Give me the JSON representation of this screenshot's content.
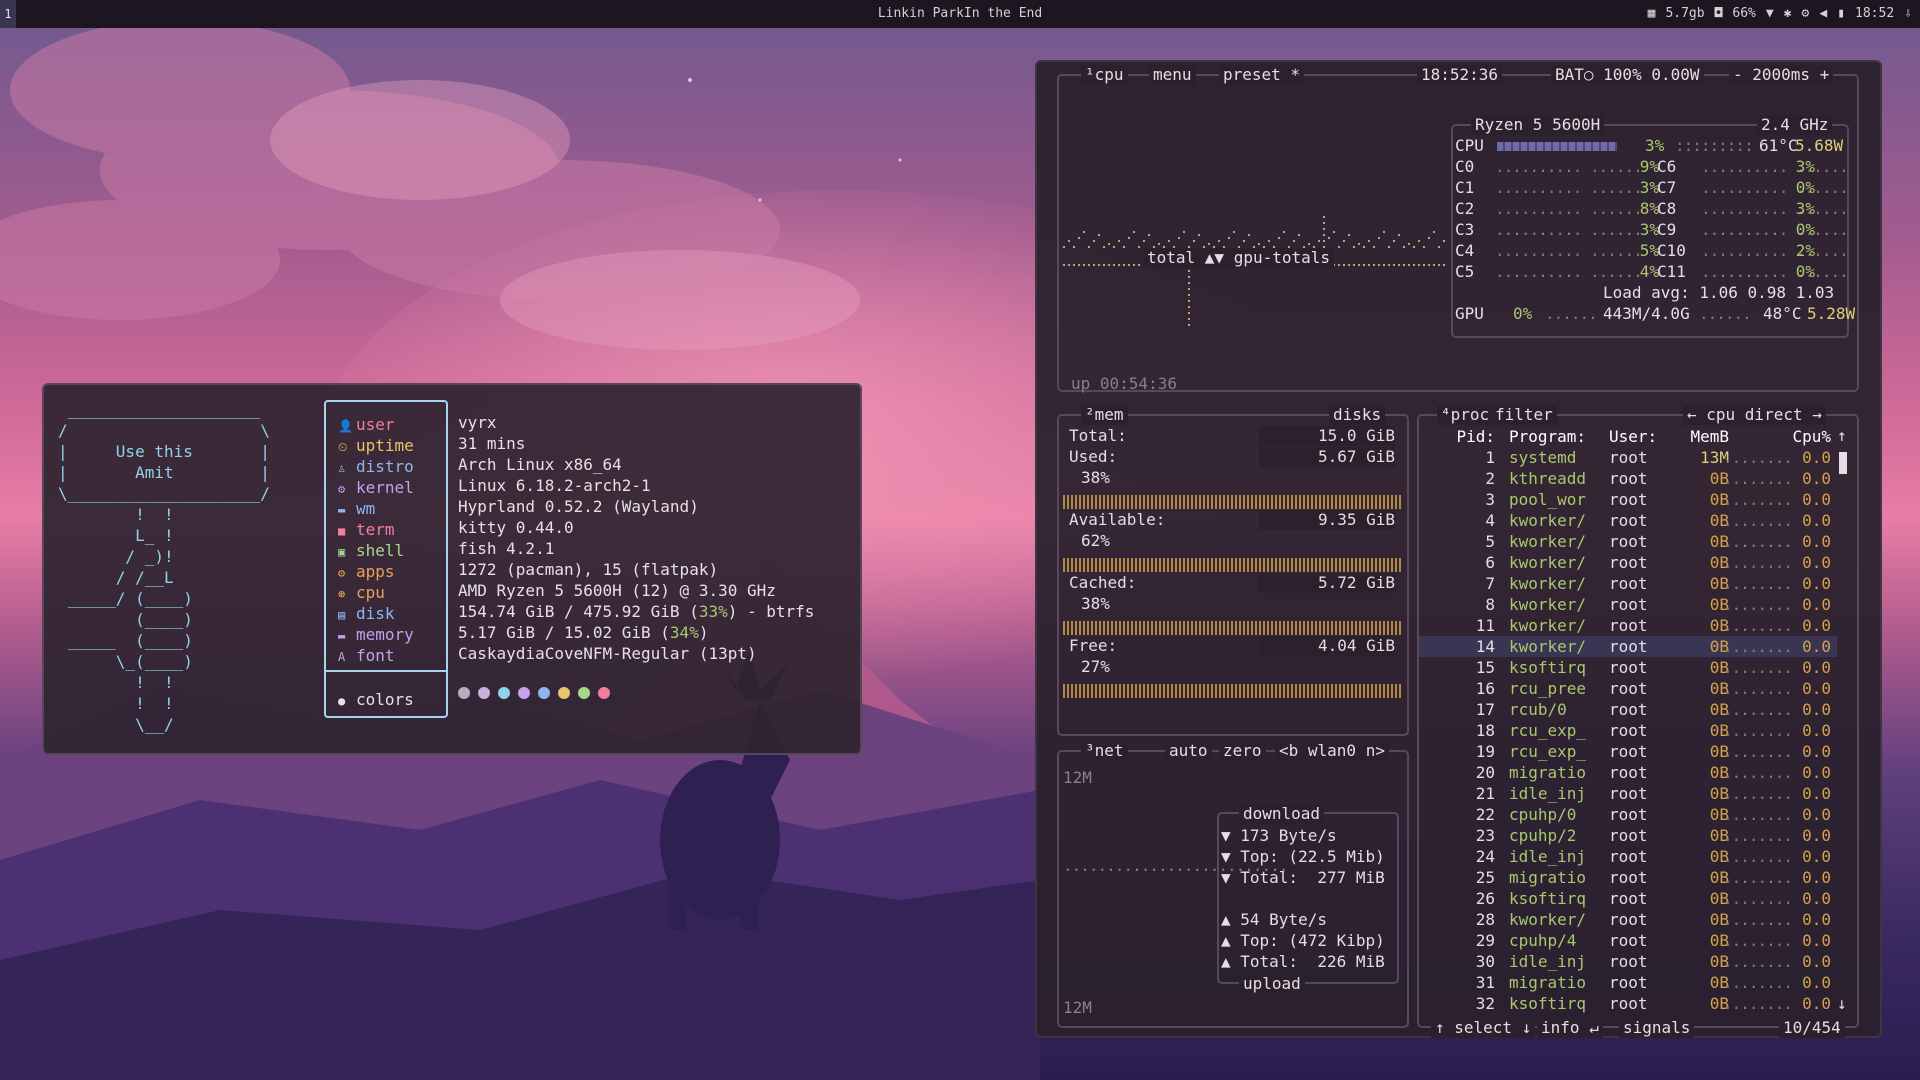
{
  "topbar": {
    "workspace": "1",
    "title": "Linkin ParkIn the End",
    "tray": {
      "memory": "5.7gb",
      "battery": "66%",
      "time": "18:52"
    }
  },
  "fastfetch": {
    "ascii": [
      " ____________________\n/                    \\\n|     Use this       |\n|       Amit         |\n\\____________________/\n        !  !\n        L_ !\n       / _)!\n      / /__L\n _____/ (____)\n        (____)\n _____  (____)\n      \\_(____)\n        !  !\n        !  !\n        \\__/"
    ],
    "keys": [
      {
        "icon": "👤",
        "label": "user",
        "color": "#ef7f9a"
      },
      {
        "icon": "⏲",
        "label": "uptime",
        "color": "#e8c46a"
      },
      {
        "icon": "♙",
        "label": "distro",
        "color": "#8fb5ef"
      },
      {
        "icon": "⚙",
        "label": "kernel",
        "color": "#c6a0ea"
      },
      {
        "icon": "▬",
        "label": "wm",
        "color": "#8fb5ef"
      },
      {
        "icon": "■",
        "label": "term",
        "color": "#ef7f9a"
      },
      {
        "icon": "▣",
        "label": "shell",
        "color": "#a8d78a"
      },
      {
        "icon": "⚙",
        "label": "apps",
        "color": "#e8a25a"
      },
      {
        "icon": "⊛",
        "label": "cpu",
        "color": "#e8a25a"
      },
      {
        "icon": "▤",
        "label": "disk",
        "color": "#8fb5ef"
      },
      {
        "icon": "▬",
        "label": "memory",
        "color": "#c6a0ea"
      },
      {
        "icon": "A",
        "label": "font",
        "color": "#c6a0ea"
      }
    ],
    "colors_label": "colors",
    "values": [
      "vyrx",
      "31 mins",
      "Arch Linux x86_64",
      "Linux 6.18.2-arch2-1",
      "Hyprland 0.52.2 (Wayland)",
      "kitty 0.44.0",
      "fish 4.2.1",
      "1272 (pacman), 15 (flatpak)",
      "AMD Ryzen 5 5600H (12) @ 3.30 GHz",
      "",
      "",
      "CaskaydiaCoveNFM-Regular (13pt)"
    ],
    "disk": {
      "pre": "154.74 GiB / 475.92 GiB (",
      "pct": "33%",
      "post": ") - btrfs"
    },
    "mem": {
      "pre": "5.17 GiB / 15.02 GiB (",
      "pct": "34%",
      "post": ")"
    },
    "palette": [
      "#b6aec0",
      "#c9b0d8",
      "#8fd2ea",
      "#c6a0ea",
      "#8fb5ef",
      "#e8c46a",
      "#a8d78a",
      "#ef7f9a"
    ]
  },
  "btop": {
    "cpu": {
      "tabs": [
        "¹cpu",
        "menu",
        "preset *"
      ],
      "clock": "18:52:36",
      "bat": "BAT○ 100% 0.00W",
      "interval": "- 2000ms +",
      "graph_label": "total ▲▼ gpu-totals",
      "uptime": "up 00:54:36",
      "model": "Ryzen 5 5600H",
      "freq": "2.4 GHz",
      "total": {
        "label": "CPU",
        "pct": "3%",
        "temp": "61°C",
        "watt": "5.68W"
      },
      "cores_left": [
        [
          "C0",
          "9%"
        ],
        [
          "C1",
          "3%"
        ],
        [
          "C2",
          "8%"
        ],
        [
          "C3",
          "3%"
        ],
        [
          "C4",
          "5%"
        ],
        [
          "C5",
          "4%"
        ]
      ],
      "cores_right": [
        [
          "C6",
          "3%"
        ],
        [
          "C7",
          "0%"
        ],
        [
          "C8",
          "3%"
        ],
        [
          "C9",
          "0%"
        ],
        [
          "C10",
          "2%"
        ],
        [
          "C11",
          "0%"
        ]
      ],
      "load": "Load avg: 1.06 0.98 1.03",
      "gpu": {
        "label": "GPU",
        "pct": "0%",
        "mem": "443M/4.0G",
        "temp": "48°C",
        "watt": "5.28W"
      }
    },
    "mem": {
      "title": "²mem",
      "disks": "disks",
      "total": [
        "Total:",
        "15.0 GiB"
      ],
      "used": [
        "Used:",
        "5.67 GiB",
        "38%"
      ],
      "available": [
        "Available:",
        "9.35 GiB",
        "62%"
      ],
      "cached": [
        "Cached:",
        "5.72 GiB",
        "38%"
      ],
      "free": [
        "Free:",
        "4.04 GiB",
        "27%"
      ]
    },
    "net": {
      "tabs": [
        "³net",
        "auto",
        "zero",
        "<b wlan0 n>"
      ],
      "scale_top": "12M",
      "scale_bottom": "12M",
      "download_label": "download",
      "down_rate": "▼ 173 Byte/s",
      "down_top": "▼ Top: (22.5 Mib)",
      "down_total": "▼ Total:  277 MiB",
      "up_rate": "▲ 54 Byte/s",
      "up_top": "▲ Top: (472 Kibp)",
      "up_total": "▲ Total:  226 MiB",
      "upload_label": "upload"
    },
    "proc": {
      "tabs": [
        "⁴proc",
        "filter",
        "← cpu direct →"
      ],
      "headers": [
        "Pid:",
        "Program:",
        "User:",
        "MemB",
        "Cpu%"
      ],
      "rows": [
        [
          "1",
          "systemd",
          "root",
          "13M",
          "0.0"
        ],
        [
          "2",
          "kthreadd",
          "root",
          "0B",
          "0.0"
        ],
        [
          "3",
          "pool_wor",
          "root",
          "0B",
          "0.0"
        ],
        [
          "4",
          "kworker/",
          "root",
          "0B",
          "0.0"
        ],
        [
          "5",
          "kworker/",
          "root",
          "0B",
          "0.0"
        ],
        [
          "6",
          "kworker/",
          "root",
          "0B",
          "0.0"
        ],
        [
          "7",
          "kworker/",
          "root",
          "0B",
          "0.0"
        ],
        [
          "8",
          "kworker/",
          "root",
          "0B",
          "0.0"
        ],
        [
          "11",
          "kworker/",
          "root",
          "0B",
          "0.0"
        ],
        [
          "14",
          "kworker/",
          "root",
          "0B",
          "0.0"
        ],
        [
          "15",
          "ksoftirq",
          "root",
          "0B",
          "0.0"
        ],
        [
          "16",
          "rcu_pree",
          "root",
          "0B",
          "0.0"
        ],
        [
          "17",
          "rcub/0",
          "root",
          "0B",
          "0.0"
        ],
        [
          "18",
          "rcu_exp_",
          "root",
          "0B",
          "0.0"
        ],
        [
          "19",
          "rcu_exp_",
          "root",
          "0B",
          "0.0"
        ],
        [
          "20",
          "migratio",
          "root",
          "0B",
          "0.0"
        ],
        [
          "21",
          "idle_inj",
          "root",
          "0B",
          "0.0"
        ],
        [
          "22",
          "cpuhp/0",
          "root",
          "0B",
          "0.0"
        ],
        [
          "23",
          "cpuhp/2",
          "root",
          "0B",
          "0.0"
        ],
        [
          "24",
          "idle_inj",
          "root",
          "0B",
          "0.0"
        ],
        [
          "25",
          "migratio",
          "root",
          "0B",
          "0.0"
        ],
        [
          "26",
          "ksoftirq",
          "root",
          "0B",
          "0.0"
        ],
        [
          "28",
          "kworker/",
          "root",
          "0B",
          "0.0"
        ],
        [
          "29",
          "cpuhp/4",
          "root",
          "0B",
          "0.0"
        ],
        [
          "30",
          "idle_inj",
          "root",
          "0B",
          "0.0"
        ],
        [
          "31",
          "migratio",
          "root",
          "0B",
          "0.0"
        ],
        [
          "32",
          "ksoftirq",
          "root",
          "0B",
          "0.0"
        ]
      ],
      "selected_index": 9,
      "footer": [
        "↑ select ↓",
        "info ↵",
        "signals",
        "10/454"
      ]
    }
  }
}
